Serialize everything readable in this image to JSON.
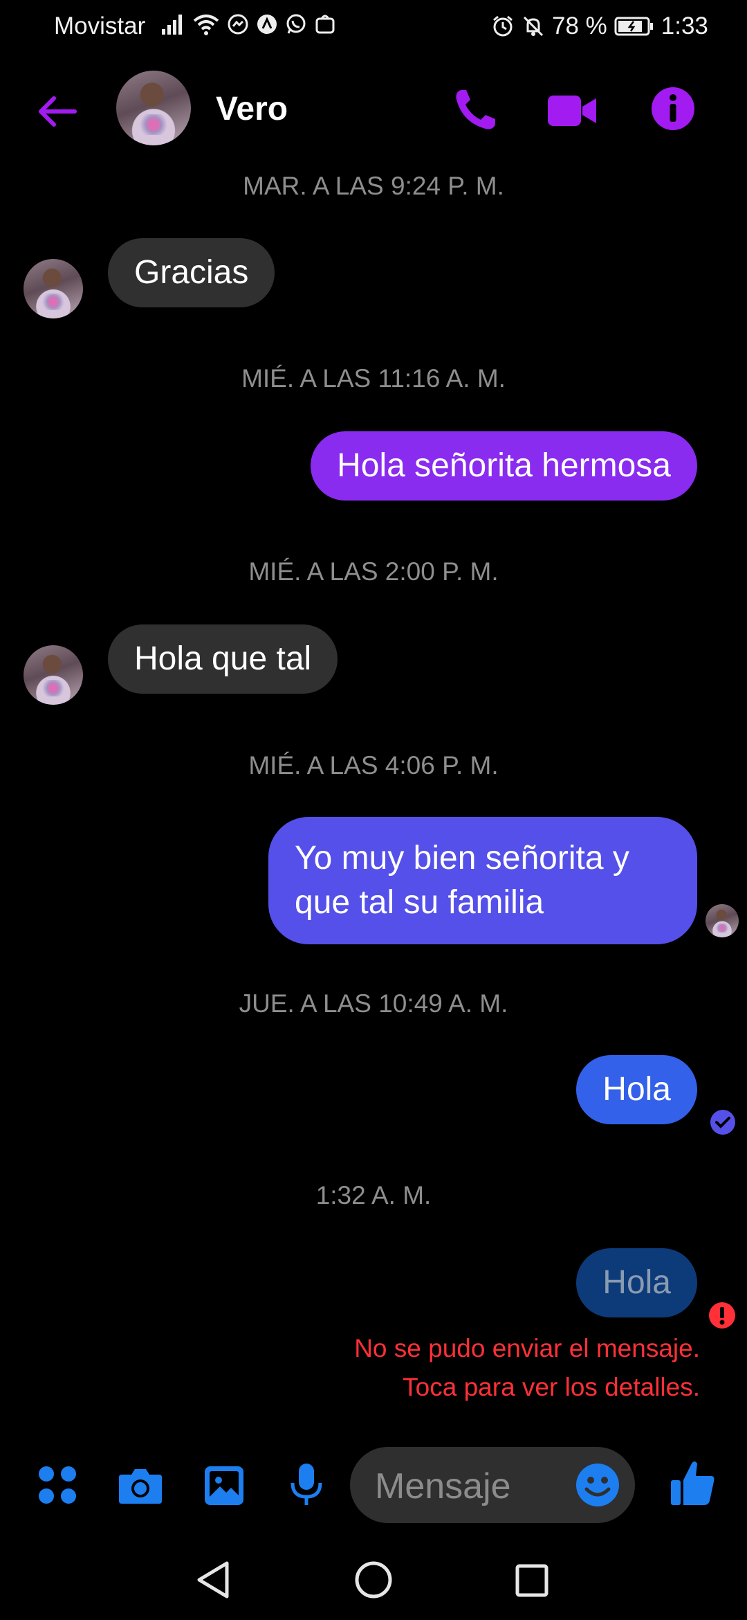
{
  "status_bar": {
    "carrier": "Movistar",
    "battery": "78 %",
    "time": "1:33"
  },
  "header": {
    "contact_name": "Vero",
    "icons": [
      "back-arrow-icon",
      "phone-icon",
      "video-camera-icon",
      "info-icon"
    ],
    "accent_color": "#a21bf0"
  },
  "conversation": {
    "timestamps": [
      "MAR. A LAS 9:24 P. M.",
      "MIÉ. A LAS 11:16 A. M.",
      "MIÉ. A LAS 2:00 P. M.",
      "MIÉ. A LAS 4:06 P. M.",
      "JUE. A LAS 10:49 A. M.",
      "1:32 A. M."
    ],
    "messages": [
      {
        "direction": "incoming",
        "text": "Gracias"
      },
      {
        "direction": "outgoing",
        "text": "Hola señorita hermosa",
        "color": "#8a2bf0"
      },
      {
        "direction": "incoming",
        "text": "Hola que tal"
      },
      {
        "direction": "outgoing",
        "text": "Yo muy bien señorita y que tal su familia",
        "color": "#5550ea"
      },
      {
        "direction": "outgoing",
        "text": "Hola",
        "color": "#3461ea",
        "status": "delivered"
      },
      {
        "direction": "outgoing",
        "text": "Hola",
        "color": "#0d3b7a",
        "status": "failed"
      }
    ],
    "error_line1": "No se pudo enviar el mensaje.",
    "error_line2": "Toca para ver los detalles."
  },
  "composer": {
    "placeholder": "Mensaje",
    "icons": [
      "apps-grid-icon",
      "camera-icon",
      "image-icon",
      "microphone-icon",
      "emoji-icon",
      "thumbs-up-icon"
    ],
    "icon_color": "#1d7ef0"
  },
  "nav_bar": {
    "icons": [
      "back-triangle-icon",
      "home-circle-icon",
      "recents-square-icon"
    ]
  }
}
